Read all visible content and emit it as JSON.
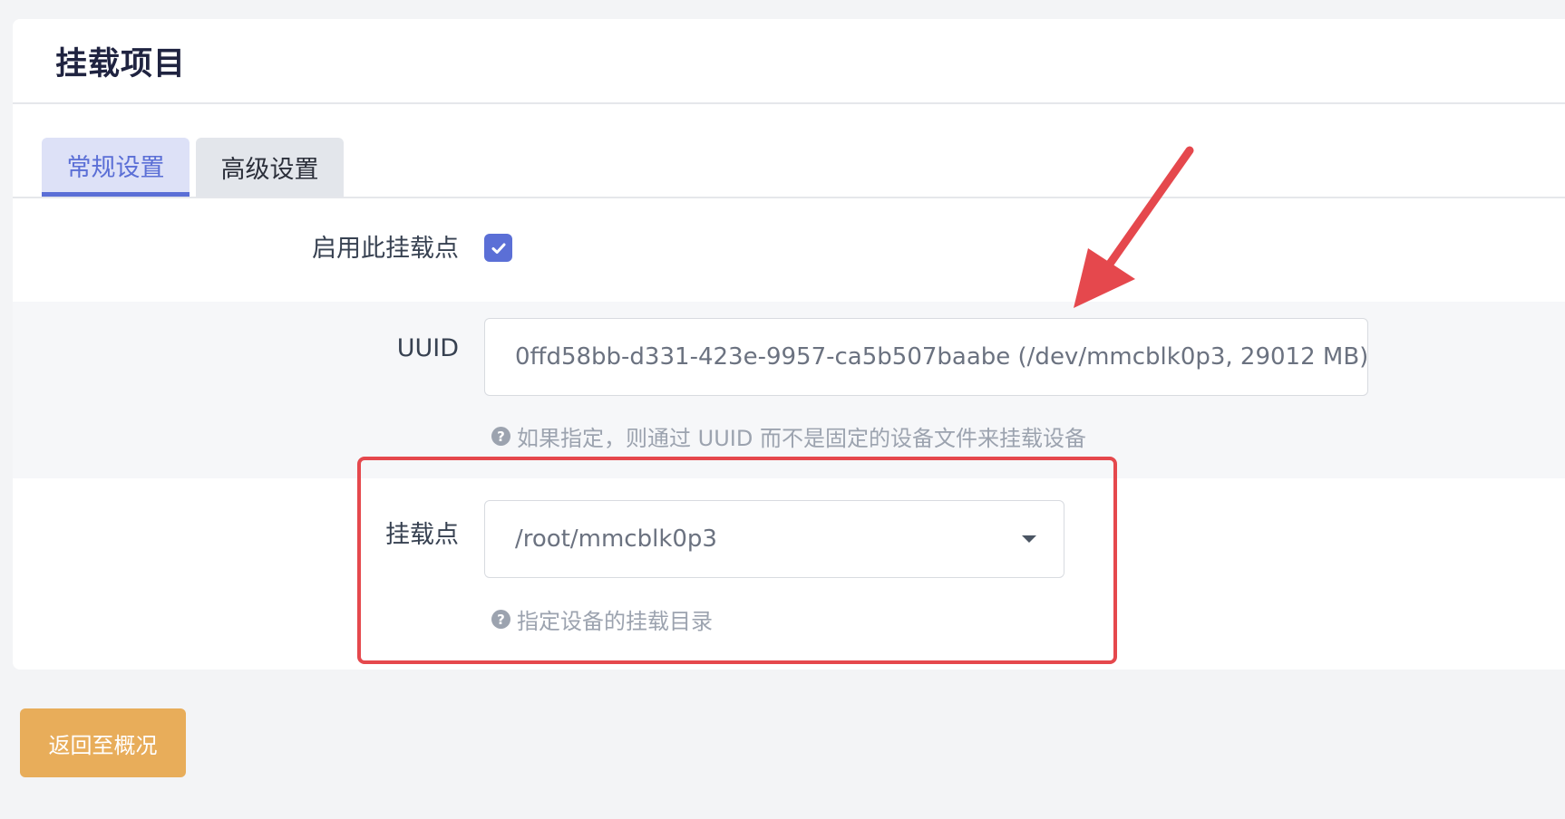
{
  "page": {
    "title": "挂载项目"
  },
  "tabs": [
    {
      "label": "常规设置",
      "active": true
    },
    {
      "label": "高级设置",
      "active": false
    }
  ],
  "form": {
    "enable": {
      "label": "启用此挂载点",
      "checked": true
    },
    "uuid": {
      "label": "UUID",
      "value": "0ffd58bb-d331-423e-9957-ca5b507baabe (/dev/mmcblk0p3, 29012 MB)",
      "hint": "如果指定，则通过 UUID 而不是固定的设备文件来挂载设备"
    },
    "mountpoint": {
      "label": "挂载点",
      "value": "/root/mmcblk0p3",
      "hint": "指定设备的挂载目录"
    }
  },
  "actions": {
    "back_label": "返回至概况"
  },
  "colors": {
    "accent": "#5b6fd6",
    "annotation": "#e5484d",
    "back_button": "#e8ad5a"
  },
  "icons": {
    "check": "check-icon",
    "help": "question-circle-icon",
    "caret": "caret-down-icon",
    "arrow": "annotation-arrow-icon"
  }
}
